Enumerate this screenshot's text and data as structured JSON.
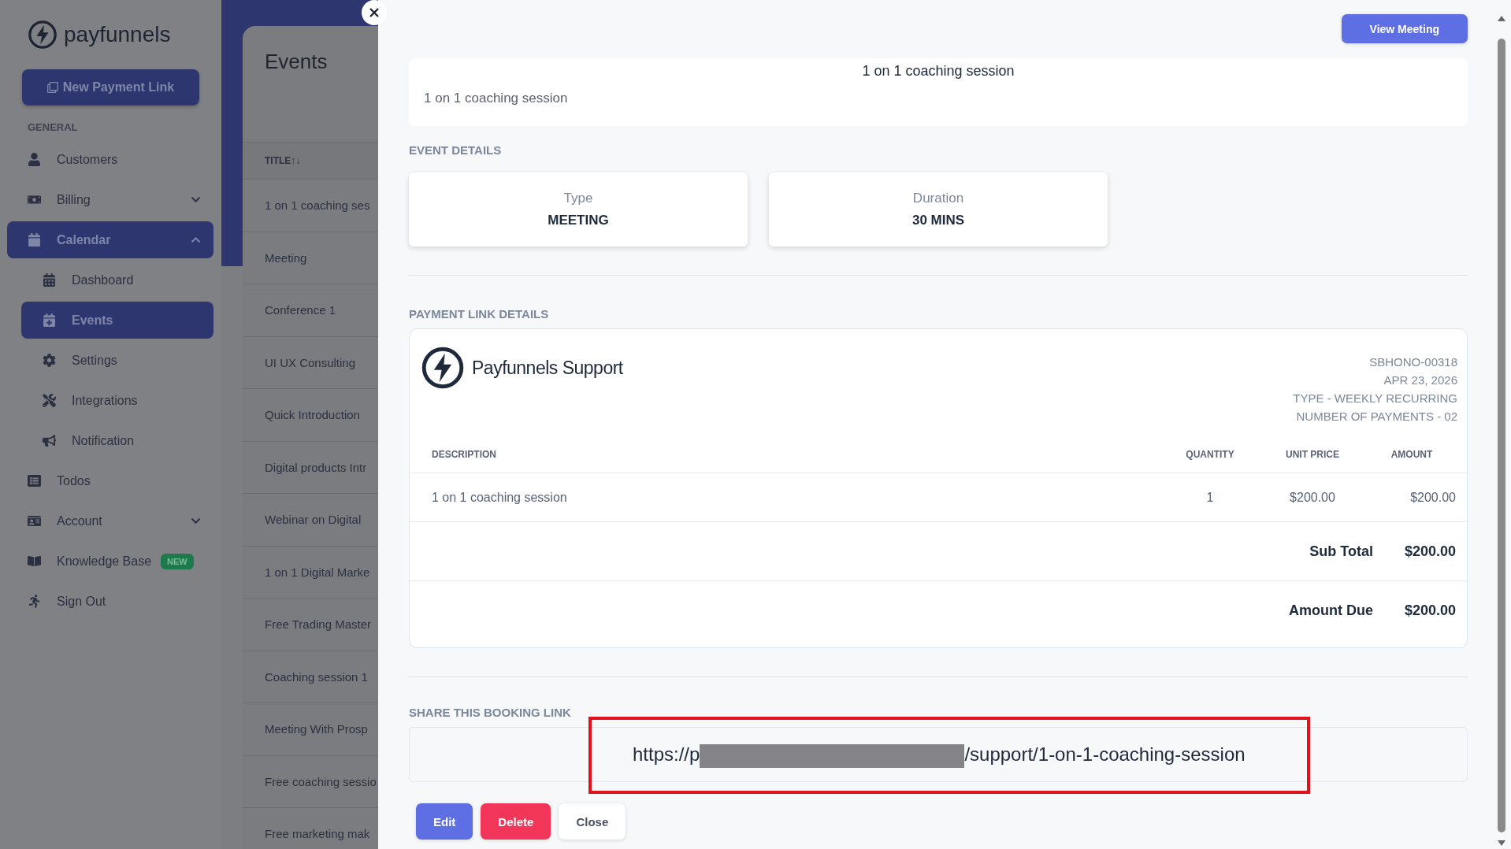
{
  "sidebar": {
    "brand": "payfunnels",
    "new_button": {
      "label": "New Payment Link"
    },
    "section_label": "GENERAL",
    "items": [
      {
        "label": "Customers",
        "selected": false
      },
      {
        "label": "Billing",
        "selected": false,
        "expanded": false
      },
      {
        "label": "Calendar",
        "selected": true,
        "expanded": true,
        "children": [
          {
            "label": "Dashboard",
            "selected": false
          },
          {
            "label": "Events",
            "selected": true
          },
          {
            "label": "Settings",
            "selected": false
          },
          {
            "label": "Integrations",
            "selected": false
          },
          {
            "label": "Notification",
            "selected": false
          }
        ]
      },
      {
        "label": "Todos",
        "selected": false
      },
      {
        "label": "Account",
        "selected": false,
        "expanded": false
      },
      {
        "label": "Knowledge Base",
        "selected": false,
        "badge": "NEW"
      },
      {
        "label": "Sign Out",
        "selected": false
      }
    ]
  },
  "events_panel": {
    "title": "Events",
    "column": "TITLE",
    "sort_icon": "↑↓",
    "rows": [
      "1 on 1 coaching ses",
      "Meeting",
      "Conference 1",
      "UI UX Consulting",
      "Quick Introduction",
      "Digital products Intr",
      "Webinar on Digital",
      "1 on 1 Digital Marke",
      "Free Trading Master",
      "Coaching session 1",
      "Meeting With Prosp",
      "Free coaching sessio",
      "Free marketing mak"
    ]
  },
  "drawer": {
    "view_button": "View Meeting",
    "summary": {
      "title": "1 on 1 coaching session",
      "subtitle": "1 on 1 coaching session"
    },
    "event_details": {
      "heading": "EVENT DETAILS",
      "cards": [
        {
          "label": "Type",
          "value": "MEETING"
        },
        {
          "label": "Duration",
          "value": "30 MINS"
        }
      ]
    },
    "payment": {
      "heading": "PAYMENT LINK DETAILS",
      "brand": "Payfunnels Support",
      "meta": [
        "SBHONO-00318",
        "APR 23, 2026",
        "TYPE - WEEKLY RECURRING",
        "NUMBER OF PAYMENTS - 02"
      ],
      "columns": [
        "DESCRIPTION",
        "QUANTITY",
        "UNIT PRICE",
        "AMOUNT"
      ],
      "items": [
        {
          "description": "1 on 1 coaching session",
          "quantity": "1",
          "unit_price": "$200.00",
          "amount": "$200.00"
        }
      ],
      "totals": [
        {
          "label": "Sub Total",
          "value": "$200.00"
        },
        {
          "label": "Amount Due",
          "value": "$200.00"
        }
      ]
    },
    "share": {
      "heading": "SHARE THIS BOOKING LINK",
      "link_start": "https://p",
      "link_end": "/support/1-on-1-coaching-session",
      "redacted": true,
      "highlighted": true
    },
    "actions": [
      {
        "label": "Edit",
        "kind": "primary"
      },
      {
        "label": "Delete",
        "kind": "danger"
      },
      {
        "label": "Close",
        "kind": "plain"
      }
    ]
  }
}
